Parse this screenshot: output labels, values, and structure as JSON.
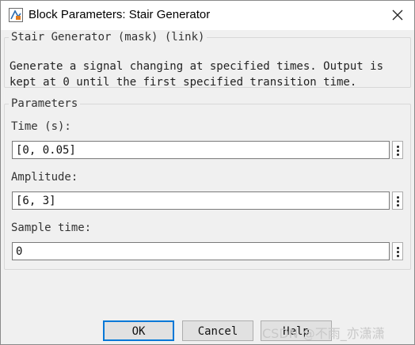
{
  "window": {
    "title": "Block Parameters: Stair Generator",
    "app_icon": "simulink-block-icon",
    "close_icon": "close-icon"
  },
  "description_group": {
    "legend": "Stair Generator (mask) (link)",
    "text": "Generate a signal changing at specified times. Output is kept at 0 until the first specified transition time."
  },
  "parameters_group": {
    "legend": "Parameters",
    "fields": [
      {
        "label": "Time (s):",
        "value": "[0, 0.05]",
        "menu_icon": "vertical-ellipsis-icon"
      },
      {
        "label": "Amplitude:",
        "value": "[6, 3]",
        "menu_icon": "vertical-ellipsis-icon"
      },
      {
        "label": "Sample time:",
        "value": "0",
        "menu_icon": "vertical-ellipsis-icon"
      }
    ]
  },
  "buttons": {
    "ok": "OK",
    "cancel": "Cancel",
    "help": "Help"
  },
  "watermark": "CSDN @不雨_亦潇潇"
}
